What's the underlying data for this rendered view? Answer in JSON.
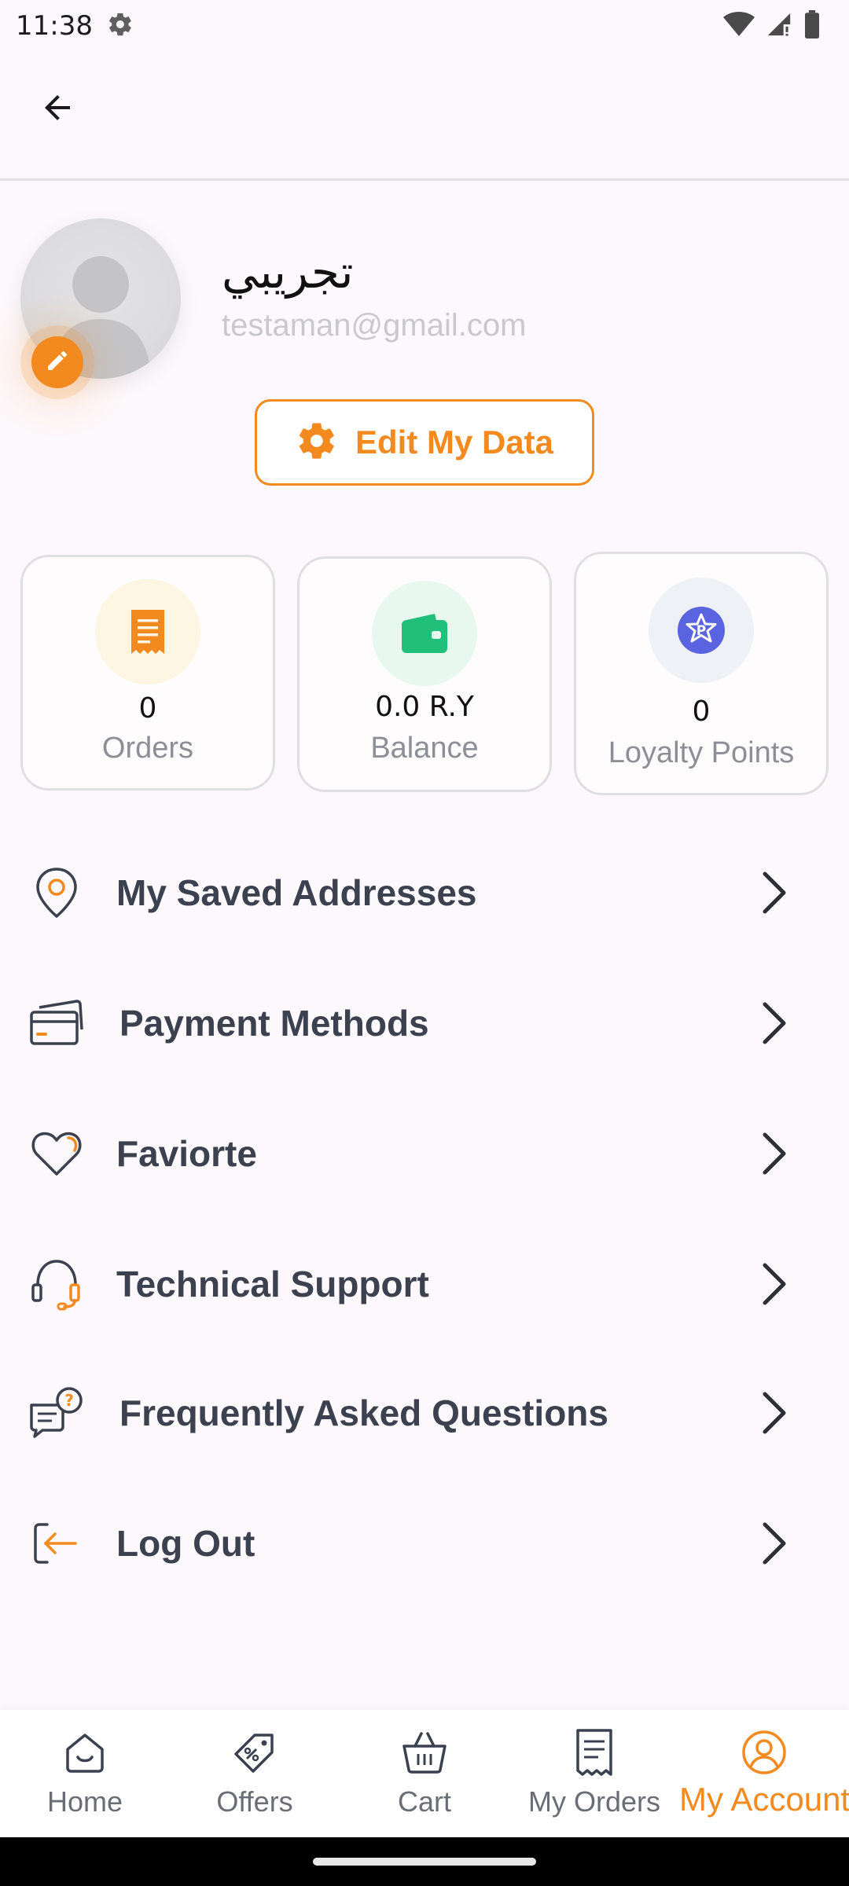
{
  "status_bar": {
    "time": "11:38",
    "icons": [
      "gear-icon",
      "wifi-icon",
      "cell-signal-icon",
      "battery-icon"
    ]
  },
  "app_bar": {
    "back_icon": "arrow-left-icon"
  },
  "profile": {
    "name": "تجريبي",
    "email": "testaman@gmail.com",
    "edit_button_label": "Edit My Data"
  },
  "stats": [
    {
      "value": "0",
      "label": "Orders",
      "icon": "receipt-icon",
      "icon_color": "#f38a1f",
      "bg": "#fdf6e3"
    },
    {
      "value": "0.0 R.Y",
      "label": "Balance",
      "icon": "wallet-icon",
      "icon_color": "#20c07a",
      "bg": "#e9f8ef"
    },
    {
      "value": "0",
      "label": "Loyalty Points",
      "icon": "loyalty-badge-icon",
      "icon_color": "#5a63e0",
      "bg": "#eef2f6"
    }
  ],
  "menu": [
    {
      "label": "My Saved Addresses",
      "icon": "location-pin-icon"
    },
    {
      "label": "Payment Methods",
      "icon": "credit-card-icon"
    },
    {
      "label": "Faviorte",
      "icon": "heart-icon"
    },
    {
      "label": "Technical Support",
      "icon": "headset-icon"
    },
    {
      "label": "Frequently Asked Questions",
      "icon": "faq-chat-icon"
    },
    {
      "label": "Log Out",
      "icon": "logout-icon"
    }
  ],
  "bottom_nav": [
    {
      "label": "Home",
      "icon": "home-icon",
      "active": false
    },
    {
      "label": "Offers",
      "icon": "tag-icon",
      "active": false
    },
    {
      "label": "Cart",
      "icon": "basket-icon",
      "active": false
    },
    {
      "label": "My Orders",
      "icon": "orders-list-icon",
      "active": false
    },
    {
      "label": "My Account",
      "icon": "account-icon",
      "active": true
    }
  ],
  "colors": {
    "accent": "#f38a1f",
    "text_primary": "#3c4150",
    "background": "#fdf8fb"
  }
}
